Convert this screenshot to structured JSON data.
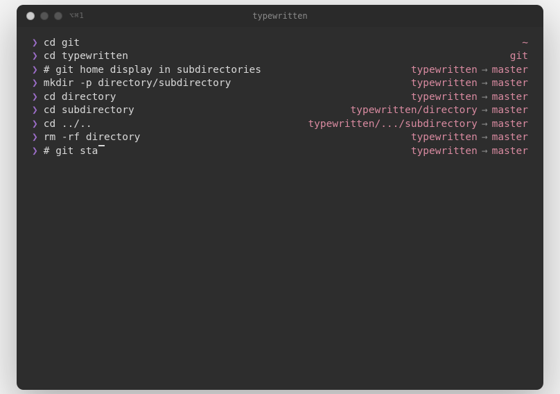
{
  "window": {
    "title": "typewritten",
    "tab_info": "⌥⌘1"
  },
  "prompt": "❯",
  "arrow": "→",
  "lines": [
    {
      "cmd": "cd git",
      "rpath": "~",
      "branch": ""
    },
    {
      "cmd": "cd typewritten",
      "rpath": "git",
      "branch": ""
    },
    {
      "cmd": "# git home display in subdirectories",
      "rpath": "typewritten",
      "branch": "master"
    },
    {
      "cmd": "mkdir -p directory/subdirectory",
      "rpath": "typewritten",
      "branch": "master"
    },
    {
      "cmd": "cd directory",
      "rpath": "typewritten",
      "branch": "master"
    },
    {
      "cmd": "cd subdirectory",
      "rpath": "typewritten/directory",
      "branch": "master"
    },
    {
      "cmd": "cd ../..",
      "rpath": "typewritten/.../subdirectory",
      "branch": "master"
    },
    {
      "cmd": "rm -rf directory",
      "rpath": "typewritten",
      "branch": "master"
    },
    {
      "cmd": "# git sta",
      "rpath": "typewritten",
      "branch": "master",
      "cursor": true
    }
  ]
}
